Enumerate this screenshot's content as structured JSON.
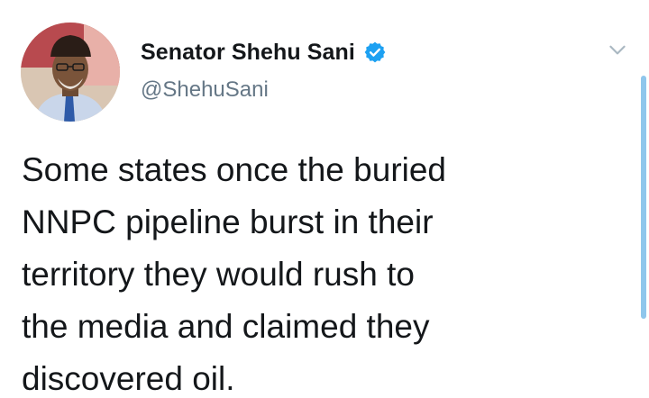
{
  "tweet": {
    "author": {
      "display_name": "Senator Shehu Sani",
      "handle": "@ShehuSani",
      "verified": true
    },
    "text_lines": [
      "Some states once the buried",
      "NNPC pipeline burst in their",
      "territory they would rush to",
      "the media and claimed they",
      "discovered oil."
    ]
  },
  "icons": {
    "verified": "verified-badge-icon",
    "menu": "chevron-down-icon"
  },
  "colors": {
    "verified_blue": "#1da1f2",
    "text_primary": "#14171a",
    "text_secondary": "#657786"
  }
}
